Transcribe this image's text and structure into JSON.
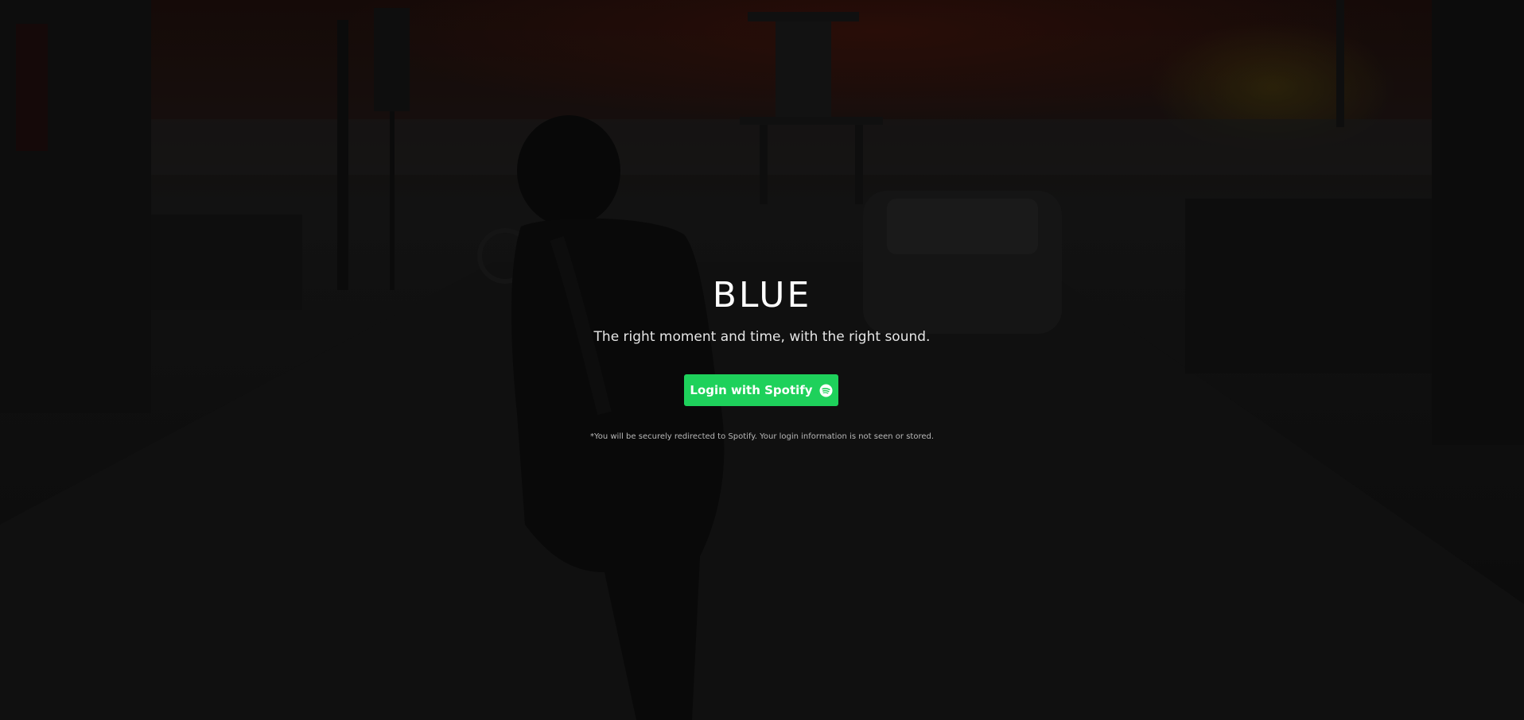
{
  "hero": {
    "title": "BLUE",
    "subtitle": "The right moment and time, with the right sound.",
    "login_label": "Login with Spotify",
    "login_icon": "spotify-icon",
    "disclaimer": "*You will be securely redirected to Spotify. Your login information is not seen or stored."
  },
  "colors": {
    "accent": "#1ed15b",
    "title": "#ffffff",
    "background": "#0d0d0d"
  }
}
